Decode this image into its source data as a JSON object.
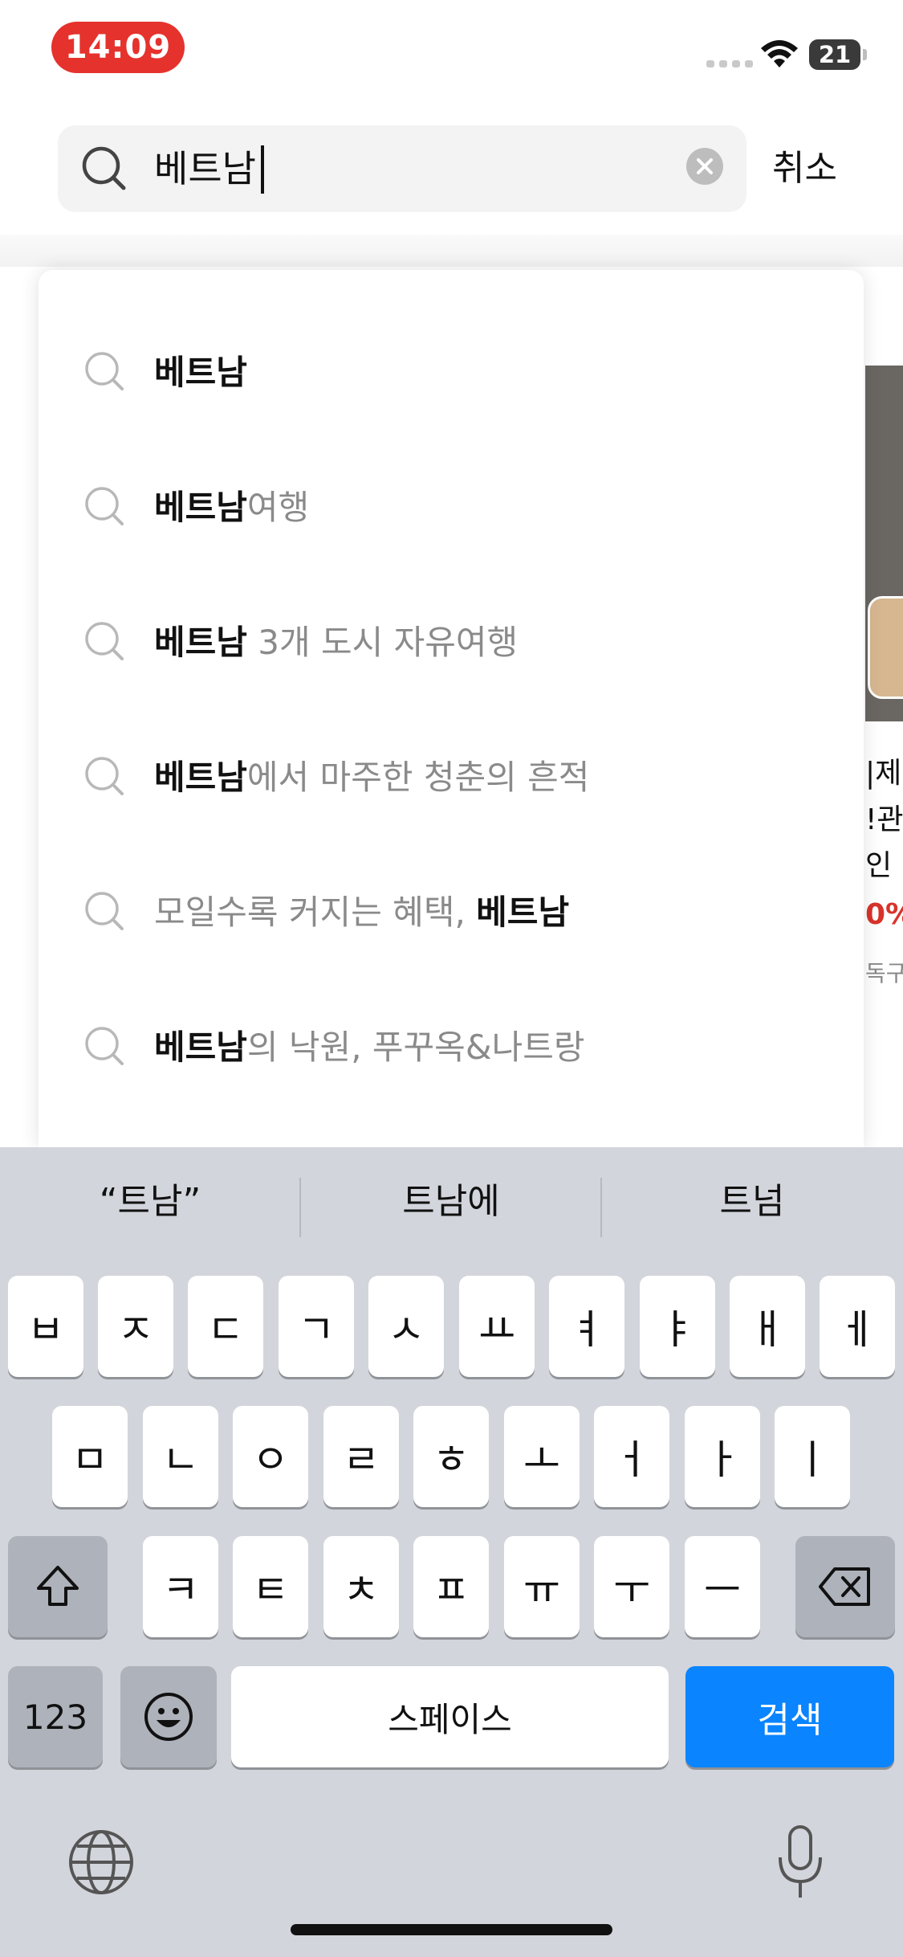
{
  "status_bar": {
    "time": "14:09",
    "battery": "21"
  },
  "search": {
    "value": "베트남",
    "cancel_label": "취소"
  },
  "suggestions": [
    {
      "parts": [
        {
          "t": "베트남",
          "hl": true
        }
      ]
    },
    {
      "parts": [
        {
          "t": "베트남",
          "hl": true
        },
        {
          "t": "여행",
          "hl": false
        }
      ]
    },
    {
      "parts": [
        {
          "t": "베트남",
          "hl": true
        },
        {
          "t": " 3개 도시 자유여행",
          "hl": false
        }
      ]
    },
    {
      "parts": [
        {
          "t": "베트남",
          "hl": true
        },
        {
          "t": "에서 마주한 청춘의 흔적",
          "hl": false
        }
      ]
    },
    {
      "parts": [
        {
          "t": "모일수록 커지는 혜택, ",
          "hl": false
        },
        {
          "t": "베트남",
          "hl": true
        }
      ]
    },
    {
      "parts": [
        {
          "t": "베트남",
          "hl": true
        },
        {
          "t": "의 낙원, 푸꾸옥&나트랑",
          "hl": false
        }
      ]
    }
  ],
  "background_peek": {
    "line1": "|제",
    "line2": "!관",
    "line3": "인",
    "percent": "0%",
    "small": "독구"
  },
  "keyboard": {
    "predictions": [
      "“트남”",
      "트남에",
      "트넘"
    ],
    "row1": [
      "ㅂ",
      "ㅈ",
      "ㄷ",
      "ㄱ",
      "ㅅ",
      "ㅛ",
      "ㅕ",
      "ㅑ",
      "ㅐ",
      "ㅔ"
    ],
    "row2": [
      "ㅁ",
      "ㄴ",
      "ㅇ",
      "ㄹ",
      "ㅎ",
      "ㅗ",
      "ㅓ",
      "ㅏ",
      "ㅣ"
    ],
    "row3": [
      "ㅋ",
      "ㅌ",
      "ㅊ",
      "ㅍ",
      "ㅠ",
      "ㅜ",
      "ㅡ"
    ],
    "numbers_label": "123",
    "space_label": "스페이스",
    "search_label": "검색"
  },
  "colors": {
    "accent": "#0a84ff",
    "time_pill": "#e5322d"
  }
}
